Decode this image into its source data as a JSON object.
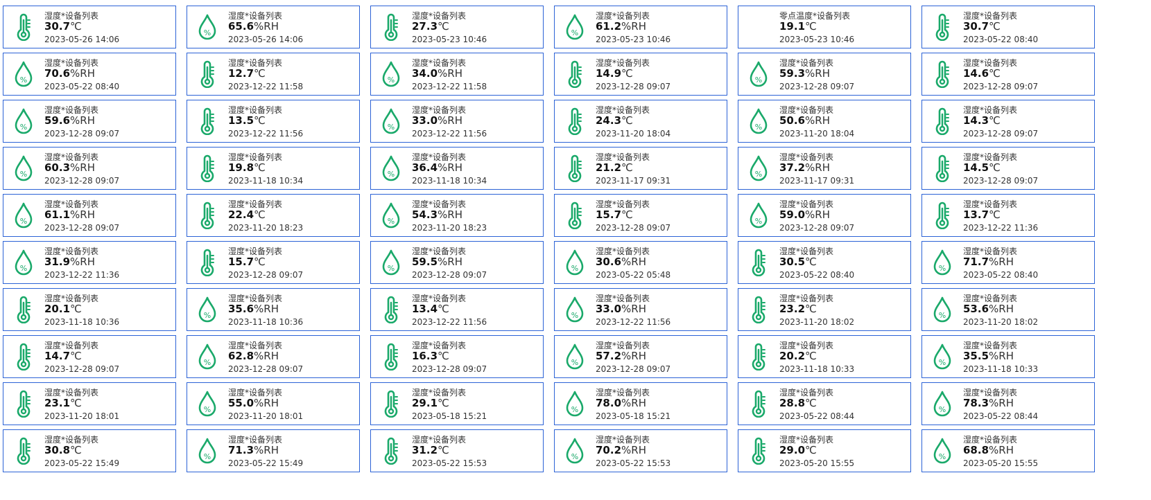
{
  "header_fragment": "",
  "colors": {
    "card_border": "#2b62d6",
    "icon": "#1aa96a"
  },
  "cards": [
    {
      "label": "湿度*设备列表",
      "value": "30.7",
      "unit": "℃",
      "time": "2023-05-26 14:06",
      "icon": "thermometer-icon"
    },
    {
      "label": "湿度*设备列表",
      "value": "65.6",
      "unit": "%RH",
      "time": "2023-05-26 14:06",
      "icon": "humidity-drop-icon"
    },
    {
      "label": "湿度*设备列表",
      "value": "27.3",
      "unit": "℃",
      "time": "2023-05-23 10:46",
      "icon": "thermometer-icon"
    },
    {
      "label": "湿度*设备列表",
      "value": "61.2",
      "unit": "%RH",
      "time": "2023-05-23 10:46",
      "icon": "humidity-drop-icon"
    },
    {
      "label": "零点温度*设备列表",
      "value": "19.1",
      "unit": "℃",
      "time": "2023-05-23 10:46",
      "icon": ""
    },
    {
      "label": "湿度*设备列表",
      "value": "30.7",
      "unit": "℃",
      "time": "2023-05-22 08:40",
      "icon": "thermometer-icon"
    },
    {
      "label": "湿度*设备列表",
      "value": "70.6",
      "unit": "%RH",
      "time": "2023-05-22 08:40",
      "icon": "humidity-drop-icon"
    },
    {
      "label": "湿度*设备列表",
      "value": "12.7",
      "unit": "℃",
      "time": "2023-12-22 11:58",
      "icon": "thermometer-icon"
    },
    {
      "label": "湿度*设备列表",
      "value": "34.0",
      "unit": "%RH",
      "time": "2023-12-22 11:58",
      "icon": "humidity-drop-icon"
    },
    {
      "label": "湿度*设备列表",
      "value": "14.9",
      "unit": "℃",
      "time": "2023-12-28 09:07",
      "icon": "thermometer-icon"
    },
    {
      "label": "湿度*设备列表",
      "value": "59.3",
      "unit": "%RH",
      "time": "2023-12-28 09:07",
      "icon": "humidity-drop-icon"
    },
    {
      "label": "湿度*设备列表",
      "value": "14.6",
      "unit": "℃",
      "time": "2023-12-28 09:07",
      "icon": "thermometer-icon"
    },
    {
      "label": "湿度*设备列表",
      "value": "59.6",
      "unit": "%RH",
      "time": "2023-12-28 09:07",
      "icon": "humidity-drop-icon"
    },
    {
      "label": "湿度*设备列表",
      "value": "13.5",
      "unit": "℃",
      "time": "2023-12-22 11:56",
      "icon": "thermometer-icon"
    },
    {
      "label": "湿度*设备列表",
      "value": "33.0",
      "unit": "%RH",
      "time": "2023-12-22 11:56",
      "icon": "humidity-drop-icon"
    },
    {
      "label": "湿度*设备列表",
      "value": "24.3",
      "unit": "℃",
      "time": "2023-11-20 18:04",
      "icon": "thermometer-icon"
    },
    {
      "label": "湿度*设备列表",
      "value": "50.6",
      "unit": "%RH",
      "time": "2023-11-20 18:04",
      "icon": "humidity-drop-icon"
    },
    {
      "label": "湿度*设备列表",
      "value": "14.3",
      "unit": "℃",
      "time": "2023-12-28 09:07",
      "icon": "thermometer-icon"
    },
    {
      "label": "湿度*设备列表",
      "value": "60.3",
      "unit": "%RH",
      "time": "2023-12-28 09:07",
      "icon": "humidity-drop-icon"
    },
    {
      "label": "湿度*设备列表",
      "value": "19.8",
      "unit": "℃",
      "time": "2023-11-18 10:34",
      "icon": "thermometer-icon"
    },
    {
      "label": "湿度*设备列表",
      "value": "36.4",
      "unit": "%RH",
      "time": "2023-11-18 10:34",
      "icon": "humidity-drop-icon"
    },
    {
      "label": "湿度*设备列表",
      "value": "21.2",
      "unit": "℃",
      "time": "2023-11-17 09:31",
      "icon": "thermometer-icon"
    },
    {
      "label": "湿度*设备列表",
      "value": "37.2",
      "unit": "%RH",
      "time": "2023-11-17 09:31",
      "icon": "humidity-drop-icon"
    },
    {
      "label": "湿度*设备列表",
      "value": "14.5",
      "unit": "℃",
      "time": "2023-12-28 09:07",
      "icon": "thermometer-icon"
    },
    {
      "label": "湿度*设备列表",
      "value": "61.1",
      "unit": "%RH",
      "time": "2023-12-28 09:07",
      "icon": "humidity-drop-icon"
    },
    {
      "label": "湿度*设备列表",
      "value": "22.4",
      "unit": "℃",
      "time": "2023-11-20 18:23",
      "icon": "thermometer-icon"
    },
    {
      "label": "湿度*设备列表",
      "value": "54.3",
      "unit": "%RH",
      "time": "2023-11-20 18:23",
      "icon": "humidity-drop-icon"
    },
    {
      "label": "湿度*设备列表",
      "value": "15.7",
      "unit": "℃",
      "time": "2023-12-28 09:07",
      "icon": "thermometer-icon"
    },
    {
      "label": "湿度*设备列表",
      "value": "59.0",
      "unit": "%RH",
      "time": "2023-12-28 09:07",
      "icon": "humidity-drop-icon"
    },
    {
      "label": "湿度*设备列表",
      "value": "13.7",
      "unit": "℃",
      "time": "2023-12-22 11:36",
      "icon": "thermometer-icon"
    },
    {
      "label": "湿度*设备列表",
      "value": "31.9",
      "unit": "%RH",
      "time": "2023-12-22 11:36",
      "icon": "humidity-drop-icon"
    },
    {
      "label": "湿度*设备列表",
      "value": "15.7",
      "unit": "℃",
      "time": "2023-12-28 09:07",
      "icon": "thermometer-icon"
    },
    {
      "label": "湿度*设备列表",
      "value": "59.5",
      "unit": "%RH",
      "time": "2023-12-28 09:07",
      "icon": "humidity-drop-icon"
    },
    {
      "label": "湿度*设备列表",
      "value": "30.6",
      "unit": "%RH",
      "time": "2023-05-22 05:48",
      "icon": "humidity-drop-icon"
    },
    {
      "label": "湿度*设备列表",
      "value": "30.5",
      "unit": "℃",
      "time": "2023-05-22 08:40",
      "icon": "thermometer-icon"
    },
    {
      "label": "湿度*设备列表",
      "value": "71.7",
      "unit": "%RH",
      "time": "2023-05-22 08:40",
      "icon": "humidity-drop-icon"
    },
    {
      "label": "湿度*设备列表",
      "value": "20.1",
      "unit": "℃",
      "time": "2023-11-18 10:36",
      "icon": "thermometer-icon"
    },
    {
      "label": "湿度*设备列表",
      "value": "35.6",
      "unit": "%RH",
      "time": "2023-11-18 10:36",
      "icon": "humidity-drop-icon"
    },
    {
      "label": "湿度*设备列表",
      "value": "13.4",
      "unit": "℃",
      "time": "2023-12-22 11:56",
      "icon": "thermometer-icon"
    },
    {
      "label": "湿度*设备列表",
      "value": "33.0",
      "unit": "%RH",
      "time": "2023-12-22 11:56",
      "icon": "humidity-drop-icon"
    },
    {
      "label": "湿度*设备列表",
      "value": "23.2",
      "unit": "℃",
      "time": "2023-11-20 18:02",
      "icon": "thermometer-icon"
    },
    {
      "label": "湿度*设备列表",
      "value": "53.6",
      "unit": "%RH",
      "time": "2023-11-20 18:02",
      "icon": "humidity-drop-icon"
    },
    {
      "label": "湿度*设备列表",
      "value": "14.7",
      "unit": "℃",
      "time": "2023-12-28 09:07",
      "icon": "thermometer-icon"
    },
    {
      "label": "湿度*设备列表",
      "value": "62.8",
      "unit": "%RH",
      "time": "2023-12-28 09:07",
      "icon": "humidity-drop-icon"
    },
    {
      "label": "湿度*设备列表",
      "value": "16.3",
      "unit": "℃",
      "time": "2023-12-28 09:07",
      "icon": "thermometer-icon"
    },
    {
      "label": "湿度*设备列表",
      "value": "57.2",
      "unit": "%RH",
      "time": "2023-12-28 09:07",
      "icon": "humidity-drop-icon"
    },
    {
      "label": "湿度*设备列表",
      "value": "20.2",
      "unit": "℃",
      "time": "2023-11-18 10:33",
      "icon": "thermometer-icon"
    },
    {
      "label": "湿度*设备列表",
      "value": "35.5",
      "unit": "%RH",
      "time": "2023-11-18 10:33",
      "icon": "humidity-drop-icon"
    },
    {
      "label": "湿度*设备列表",
      "value": "23.1",
      "unit": "℃",
      "time": "2023-11-20 18:01",
      "icon": "thermometer-icon"
    },
    {
      "label": "湿度*设备列表",
      "value": "55.0",
      "unit": "%RH",
      "time": "2023-11-20 18:01",
      "icon": "humidity-drop-icon"
    },
    {
      "label": "湿度*设备列表",
      "value": "29.1",
      "unit": "℃",
      "time": "2023-05-18 15:21",
      "icon": "thermometer-icon"
    },
    {
      "label": "湿度*设备列表",
      "value": "78.0",
      "unit": "%RH",
      "time": "2023-05-18 15:21",
      "icon": "humidity-drop-icon"
    },
    {
      "label": "湿度*设备列表",
      "value": "28.8",
      "unit": "℃",
      "time": "2023-05-22 08:44",
      "icon": "thermometer-icon"
    },
    {
      "label": "湿度*设备列表",
      "value": "78.3",
      "unit": "%RH",
      "time": "2023-05-22 08:44",
      "icon": "humidity-drop-icon"
    },
    {
      "label": "湿度*设备列表",
      "value": "30.8",
      "unit": "℃",
      "time": "2023-05-22 15:49",
      "icon": "thermometer-icon"
    },
    {
      "label": "湿度*设备列表",
      "value": "71.3",
      "unit": "%RH",
      "time": "2023-05-22 15:49",
      "icon": "humidity-drop-icon"
    },
    {
      "label": "湿度*设备列表",
      "value": "31.2",
      "unit": "℃",
      "time": "2023-05-22 15:53",
      "icon": "thermometer-icon"
    },
    {
      "label": "湿度*设备列表",
      "value": "70.2",
      "unit": "%RH",
      "time": "2023-05-22 15:53",
      "icon": "humidity-drop-icon"
    },
    {
      "label": "湿度*设备列表",
      "value": "29.0",
      "unit": "℃",
      "time": "2023-05-20 15:55",
      "icon": "thermometer-icon"
    },
    {
      "label": "湿度*设备列表",
      "value": "68.8",
      "unit": "%RH",
      "time": "2023-05-20 15:55",
      "icon": "humidity-drop-icon"
    }
  ]
}
